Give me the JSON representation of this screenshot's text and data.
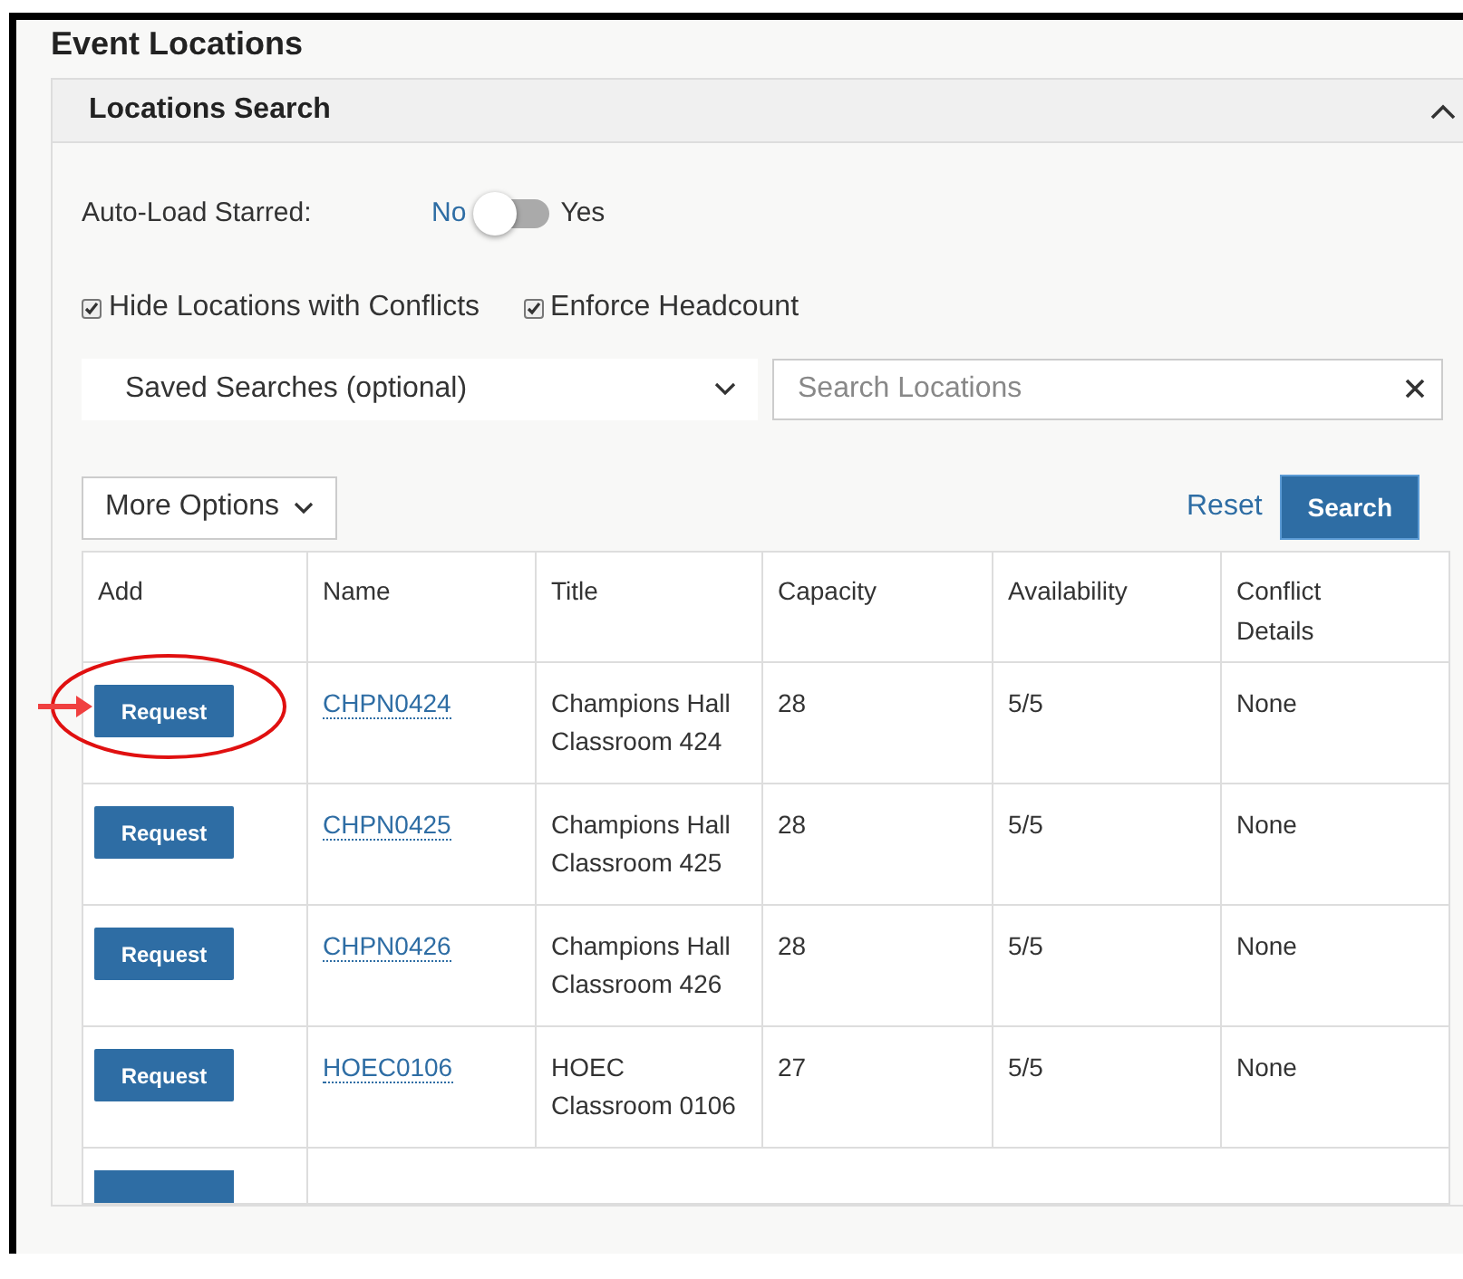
{
  "page_title": "Event Locations",
  "panel": {
    "title": "Locations Search",
    "expanded": true
  },
  "auto_load": {
    "label": "Auto-Load Starred:",
    "off_label": "No",
    "on_label": "Yes",
    "on": false
  },
  "checkboxes": [
    {
      "label": "Hide Locations with Conflicts",
      "checked": true
    },
    {
      "label": "Enforce Headcount",
      "checked": true
    }
  ],
  "saved_searches": {
    "value": "Saved Searches (optional)"
  },
  "search": {
    "placeholder": "Search Locations"
  },
  "more_options": "More Options",
  "reset": "Reset",
  "search_button": "Search",
  "table": {
    "columns": [
      "Add",
      "Name",
      "Title",
      "Capacity",
      "Availability",
      "Conflict Details"
    ],
    "rows": [
      {
        "add": "Request",
        "name": "CHPN0424",
        "title": "Champions Hall Classroom 424",
        "capacity": "28",
        "availability": "5/5",
        "conflict": "None",
        "highlighted": true
      },
      {
        "add": "Request",
        "name": "CHPN0425",
        "title": "Champions Hall Classroom 425",
        "capacity": "28",
        "availability": "5/5",
        "conflict": "None",
        "highlighted": false
      },
      {
        "add": "Request",
        "name": "CHPN0426",
        "title": "Champions Hall Classroom 426",
        "capacity": "28",
        "availability": "5/5",
        "conflict": "None",
        "highlighted": false
      },
      {
        "add": "Request",
        "name": "HOEC0106",
        "title": "HOEC Classroom 0106",
        "capacity": "27",
        "availability": "5/5",
        "conflict": "None",
        "highlighted": false
      }
    ]
  }
}
